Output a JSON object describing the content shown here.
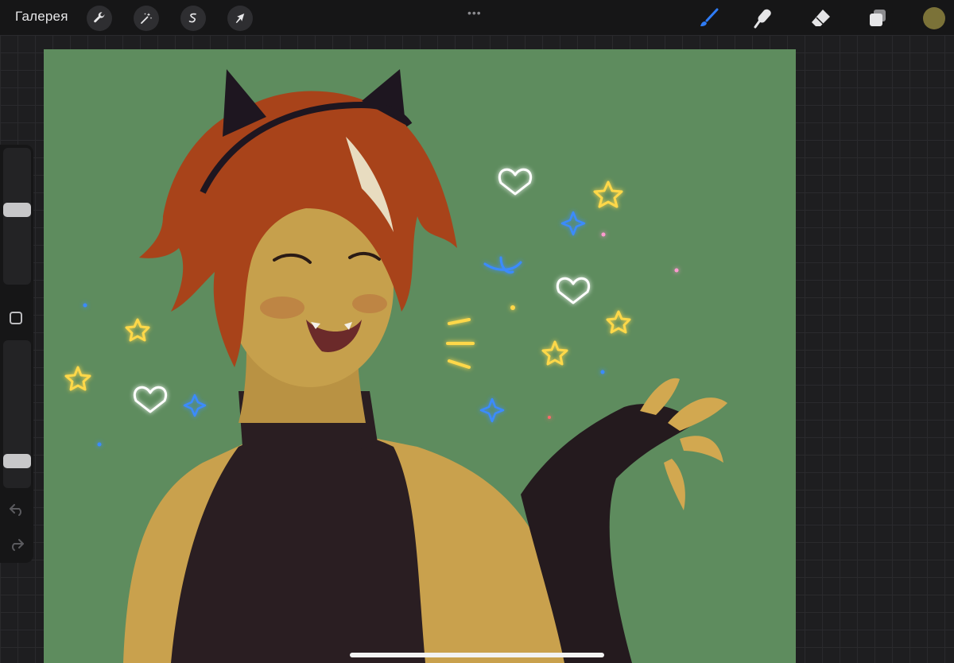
{
  "topbar": {
    "gallery_label": "Галерея",
    "left_tools": [
      {
        "name": "actions",
        "icon": "wrench-icon"
      },
      {
        "name": "adjustments",
        "icon": "magic-wand-icon"
      },
      {
        "name": "selection",
        "icon": "selection-s-icon"
      },
      {
        "name": "transform",
        "icon": "arrow-cursor-icon"
      }
    ],
    "more_label": "•••",
    "right_tools": [
      {
        "name": "brush",
        "icon": "brush-icon",
        "active": true
      },
      {
        "name": "smudge",
        "icon": "smudge-finger-icon",
        "active": false
      },
      {
        "name": "eraser",
        "icon": "eraser-icon",
        "active": false
      },
      {
        "name": "layers",
        "icon": "layers-icon",
        "active": false
      }
    ],
    "current_color": "#7b7238"
  },
  "sidebar": {
    "size_slider_level": 0.45,
    "opacity_slider_level": 0.85,
    "modify_button": "square-icon",
    "undo_icon": "undo-arrow-icon",
    "redo_icon": "redo-arrow-icon"
  },
  "canvas": {
    "background_color": "#5e8c5e",
    "artwork": "artwork-illustration"
  },
  "colors": {
    "accent_blue": "#2f7cf6",
    "chrome_dark": "#161617"
  }
}
